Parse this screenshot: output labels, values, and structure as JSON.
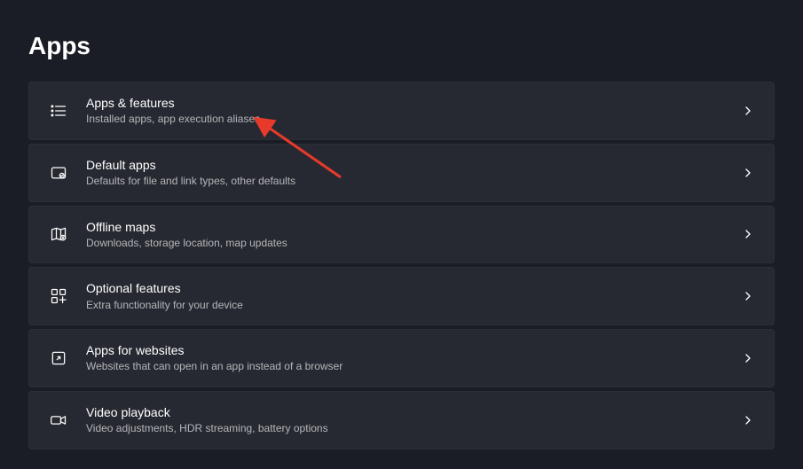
{
  "page": {
    "title": "Apps"
  },
  "items": [
    {
      "id": "apps-features",
      "title": "Apps & features",
      "subtitle": "Installed apps, app execution aliases"
    },
    {
      "id": "default-apps",
      "title": "Default apps",
      "subtitle": "Defaults for file and link types, other defaults"
    },
    {
      "id": "offline-maps",
      "title": "Offline maps",
      "subtitle": "Downloads, storage location, map updates"
    },
    {
      "id": "optional-features",
      "title": "Optional features",
      "subtitle": "Extra functionality for your device"
    },
    {
      "id": "apps-for-websites",
      "title": "Apps for websites",
      "subtitle": "Websites that can open in an app instead of a browser"
    },
    {
      "id": "video-playback",
      "title": "Video playback",
      "subtitle": "Video adjustments, HDR streaming, battery options"
    }
  ]
}
